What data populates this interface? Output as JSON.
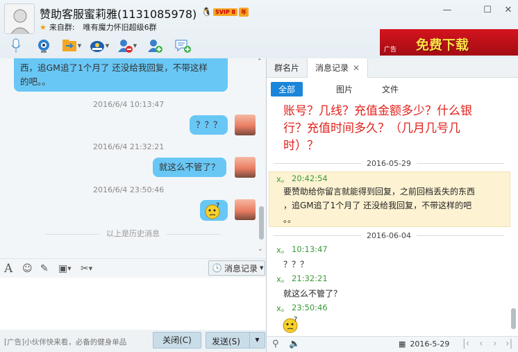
{
  "header": {
    "title": "赞助客服蜜莉雅(1131085978)",
    "vip_badge": "SVIP 8",
    "year_badge": "年",
    "source_label": "来自群:",
    "source_group": "唯有魔力怀旧超级6群"
  },
  "ad": {
    "label": "广告",
    "text": "免费下载"
  },
  "toolbar": {
    "items": [
      "microphone-icon",
      "video-camera-icon",
      "file-transfer-icon",
      "remote-assist-icon",
      "block-user-icon",
      "add-friend-icon",
      "message-icon"
    ]
  },
  "chat": {
    "messages": [
      {
        "kind": "incoming",
        "text_lines": [
          "西，追GM追了1个月了 还没给我回复，不带这样",
          "的吧。。"
        ]
      },
      {
        "kind": "timestamp",
        "text": "2016/6/4 10:13:47"
      },
      {
        "kind": "outgoing",
        "text": "？？？"
      },
      {
        "kind": "timestamp",
        "text": "2016/6/4 21:32:21"
      },
      {
        "kind": "outgoing",
        "text": "就这么不管了？"
      },
      {
        "kind": "timestamp",
        "text": "2016/6/4 23:50:46"
      },
      {
        "kind": "outgoing_emoji",
        "text": ""
      }
    ],
    "history_divider": "以上是历史消息"
  },
  "compose": {
    "history_button": "消息记录",
    "ad_line": "[广告]小伙伴快来看，必备的健身单品",
    "close_button": "关闭(C)",
    "send_button": "发送(S)"
  },
  "right_panel": {
    "tabs": [
      "群名片",
      "消息记录"
    ],
    "filters": [
      "全部",
      "图片",
      "文件"
    ],
    "notice": "账号？几线？充值金额多少？什么银行？充值时间多久？（几月几号几时）？",
    "date1": "2016-05-29",
    "highlight": {
      "sender": "x。",
      "time": "20:42:54",
      "text_lines": [
        "要赞助给你留言就能得到回复，之前回档丢失的东西",
        "，追GM追了1个月了 还没给我回复，不带这样的吧",
        "。。"
      ]
    },
    "date2": "2016-06-04",
    "entries": [
      {
        "sender": "x。",
        "time": "10:13:47",
        "text": "？？？"
      },
      {
        "sender": "x。",
        "time": "21:32:21",
        "text": "就这么不管了？"
      },
      {
        "sender": "x。",
        "time": "23:50:46",
        "text": ""
      }
    ],
    "footer_date": "2016-5-29"
  },
  "colors": {
    "bubble": "#68c7f5",
    "accent": "#1b86d9",
    "notice": "#e2201a",
    "sender": "#3a9a3a"
  }
}
